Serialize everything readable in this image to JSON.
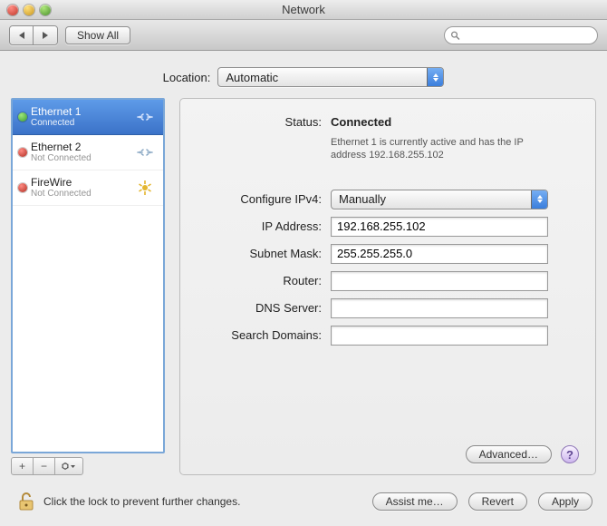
{
  "window": {
    "title": "Network"
  },
  "toolbar": {
    "show_all": "Show All",
    "search_placeholder": ""
  },
  "location": {
    "label": "Location:",
    "value": "Automatic"
  },
  "sidebar": {
    "items": [
      {
        "name": "Ethernet 1",
        "sub": "Connected",
        "status": "green",
        "iface": "eth"
      },
      {
        "name": "Ethernet 2",
        "sub": "Not Connected",
        "status": "red",
        "iface": "eth"
      },
      {
        "name": "FireWire",
        "sub": "Not Connected",
        "status": "red",
        "iface": "fw"
      }
    ],
    "buttons": {
      "add": "+",
      "remove": "−",
      "action": "✻▾"
    }
  },
  "detail": {
    "labels": {
      "status": "Status:",
      "configure": "Configure IPv4:",
      "ip": "IP Address:",
      "subnet": "Subnet Mask:",
      "router": "Router:",
      "dns": "DNS Server:",
      "search": "Search Domains:"
    },
    "status_value": "Connected",
    "status_desc": "Ethernet 1 is currently active and has the IP address 192.168.255.102",
    "configure_value": "Manually",
    "ip_value": "192.168.255.102",
    "subnet_value": "255.255.255.0",
    "router_value": "",
    "dns_value": "",
    "search_value": "",
    "advanced": "Advanced…",
    "help": "?"
  },
  "footer": {
    "lock_text": "Click the lock to prevent further changes.",
    "assist": "Assist me…",
    "revert": "Revert",
    "apply": "Apply"
  }
}
